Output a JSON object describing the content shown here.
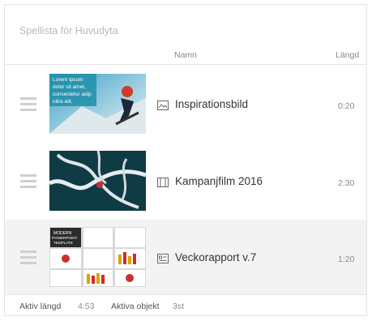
{
  "playlist": {
    "title": "Spellista för Huvudyta",
    "columns": {
      "name": "Namn",
      "length": "Längd"
    },
    "items": [
      {
        "name": "Inspirationsbild",
        "type_icon": "image-icon",
        "length": "0:20",
        "thumb_text": [
          "Lorem ipsum",
          "dolor sit amet,",
          "consectetur adip",
          "nitra elit."
        ]
      },
      {
        "name": "Kampanjfilm 2016",
        "type_icon": "video-icon",
        "length": "2:30"
      },
      {
        "name": "Veckorapport v.7",
        "type_icon": "presentation-icon",
        "length": "1:20",
        "thumb_text": [
          "MODERN",
          "POWERPOINT",
          "TEMPLATE"
        ]
      }
    ]
  },
  "footer": {
    "active_length_label": "Aktiv längd",
    "active_length_value": "4:53",
    "active_items_label": "Aktiva objekt",
    "active_items_value": "3st"
  }
}
